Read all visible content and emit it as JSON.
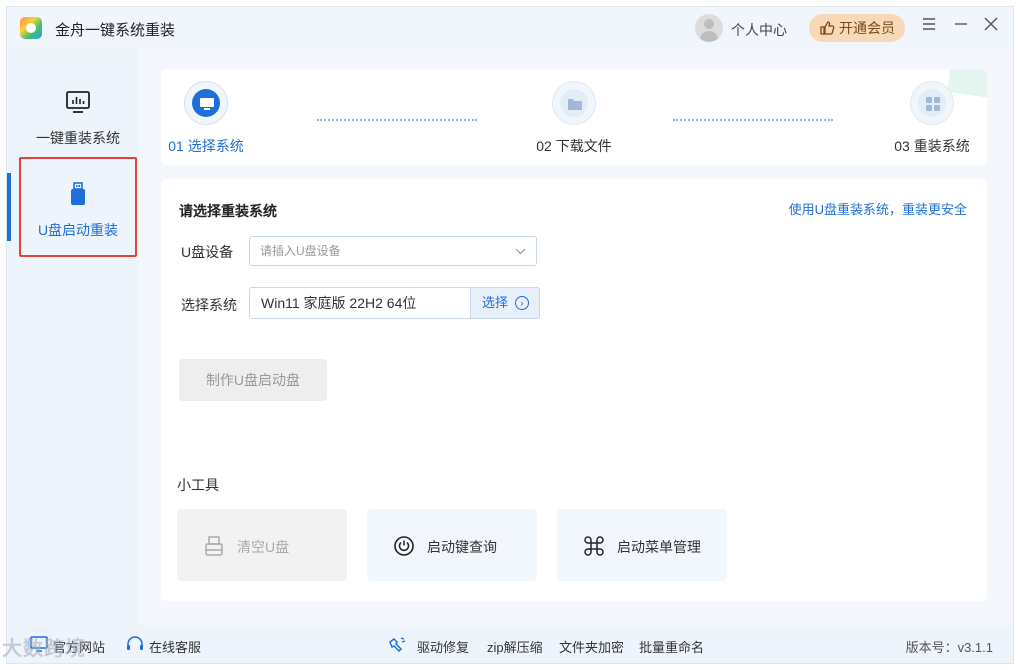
{
  "app": {
    "title": "金舟一键系统重装"
  },
  "titlebar": {
    "user_center": "个人中心",
    "vip_label": "开通会员",
    "menu_icon": "menu-icon",
    "minimize_icon": "minimize-icon",
    "close_icon": "close-icon"
  },
  "sidebar": {
    "items": [
      {
        "label": "一键重装系统",
        "icon": "monitor-chart-icon",
        "active": false
      },
      {
        "label": "U盘启动重装",
        "icon": "usb-drive-icon",
        "active": true
      }
    ]
  },
  "steps": [
    {
      "label": "01 选择系统",
      "icon": "monitor-icon",
      "active": true
    },
    {
      "label": "02 下载文件",
      "icon": "folder-icon",
      "active": false
    },
    {
      "label": "03 重装系统",
      "icon": "grid-icon",
      "active": false
    }
  ],
  "form": {
    "title": "请选择重装系统",
    "safety_link": "使用U盘重装系统，重装更安全",
    "usb_label": "U盘设备",
    "usb_placeholder": "请插入U盘设备",
    "os_label": "选择系统",
    "os_value": "Win11 家庭版 22H2 64位",
    "choose_label": "选择",
    "make_button": "制作U盘启动盘"
  },
  "tools": {
    "title": "小工具",
    "items": [
      {
        "label": "清空U盘",
        "icon": "usb-clear-icon",
        "enabled": false
      },
      {
        "label": "启动键查询",
        "icon": "power-icon",
        "enabled": true
      },
      {
        "label": "启动菜单管理",
        "icon": "command-icon",
        "enabled": true
      }
    ]
  },
  "footer": {
    "official_site": "官方网站",
    "online_service": "在线客服",
    "driver_repair": "驱动修复",
    "zip": "zip解压缩",
    "folder_encrypt": "文件夹加密",
    "batch_rename": "批量重命名",
    "version": "版本号：v3.1.1"
  },
  "watermark": "大数跨境",
  "colors": {
    "accent": "#1e6fd9",
    "highlight_border": "#e0453a",
    "vip_bg": "#f7d9b8",
    "background": "#eef4fb"
  }
}
